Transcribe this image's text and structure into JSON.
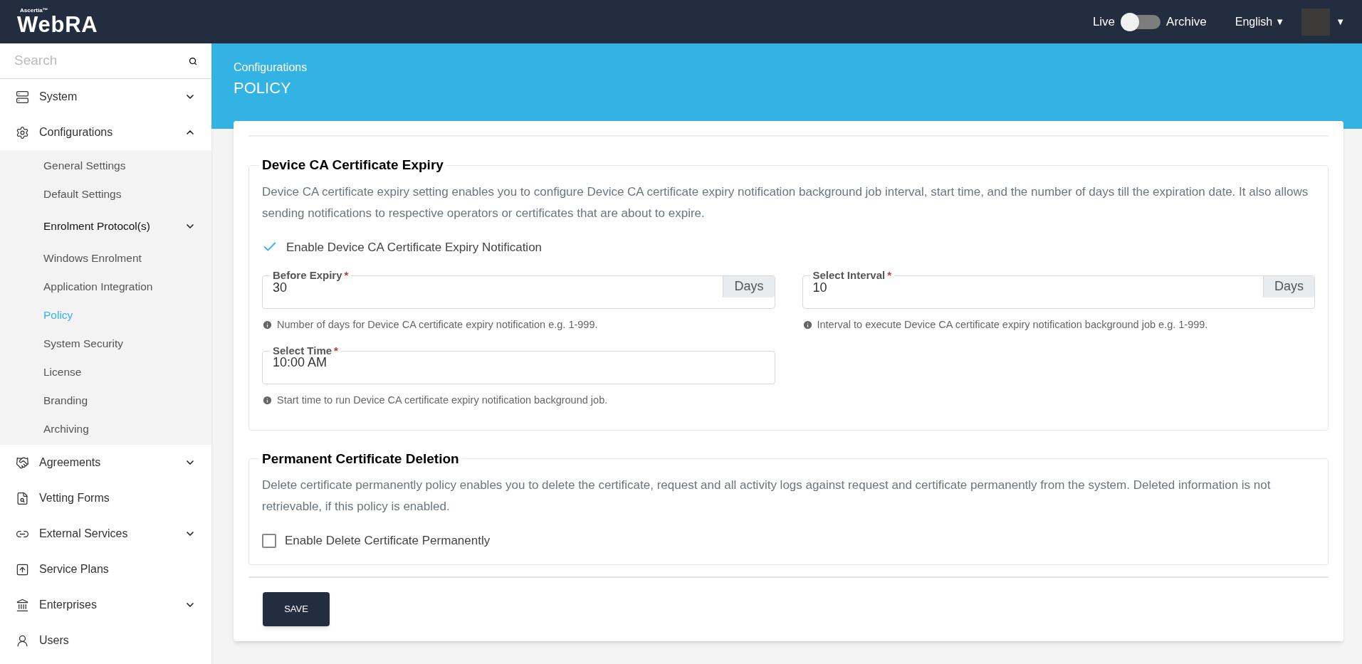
{
  "header": {
    "logo": {
      "superscript": "Ascertia™",
      "name": "WebRA"
    },
    "mode_toggle": {
      "left_label": "Live",
      "right_label": "Archive",
      "on": false
    },
    "language": {
      "label": "English",
      "caret": "▼"
    },
    "user_menu": {
      "caret": "▼"
    }
  },
  "sidebar": {
    "search": {
      "placeholder": "Search"
    },
    "items": [
      {
        "label": "System",
        "expanded": false
      },
      {
        "label": "Configurations",
        "expanded": true,
        "children": [
          {
            "label": "General Settings",
            "selected": false
          },
          {
            "label": "Default Settings",
            "selected": false
          },
          {
            "label": "Enrolment Protocol(s)",
            "selected": false,
            "expanded": false
          },
          {
            "label": "Windows Enrolment",
            "selected": false
          },
          {
            "label": "Application Integration",
            "selected": false
          },
          {
            "label": "Policy",
            "selected": true
          },
          {
            "label": "System Security",
            "selected": false
          },
          {
            "label": "License",
            "selected": false
          },
          {
            "label": "Branding",
            "selected": false
          },
          {
            "label": "Archiving",
            "selected": false
          }
        ]
      },
      {
        "label": "Agreements",
        "expanded": false
      },
      {
        "label": "Vetting Forms"
      },
      {
        "label": "External Services",
        "expanded": false
      },
      {
        "label": "Service Plans"
      },
      {
        "label": "Enterprises",
        "expanded": false
      },
      {
        "label": "Users"
      }
    ]
  },
  "page": {
    "breadcrumb": "Configurations",
    "title": "POLICY"
  },
  "sections": [
    {
      "title": "Device CA Certificate Expiry",
      "description": "Device CA certificate expiry setting enables you to configure Device CA certificate expiry notification background job interval, start time, and the number of days till the expiration date. It also allows sending notifications to respective operators or certificates that are about to expire.",
      "checkbox": {
        "label": "Enable Device CA Certificate Expiry Notification",
        "checked": true
      },
      "fields": [
        {
          "label": "Before Expiry",
          "required_mark": "*",
          "value": "30",
          "suffix": "Days",
          "hint": "Number of days for Device CA certificate expiry notification e.g. 1-999."
        },
        {
          "label": "Select Interval",
          "required_mark": "*",
          "value": "10",
          "suffix": "Days",
          "hint": "Interval to execute Device CA certificate expiry notification background job e.g. 1-999."
        },
        {
          "label": "Select Time",
          "required_mark": "*",
          "value": "10:00 AM",
          "hint": "Start time to run Device CA certificate expiry notification background job."
        }
      ]
    },
    {
      "title": "Permanent Certificate Deletion",
      "description": "Delete certificate permanently policy enables you to delete the certificate, request and all activity logs against request and certificate permanently from the system. Deleted information is not retrievable, if this policy is enabled.",
      "checkbox": {
        "label": "Enable Delete Certificate Permanently",
        "checked": false
      }
    }
  ],
  "save_button": "SAVE"
}
